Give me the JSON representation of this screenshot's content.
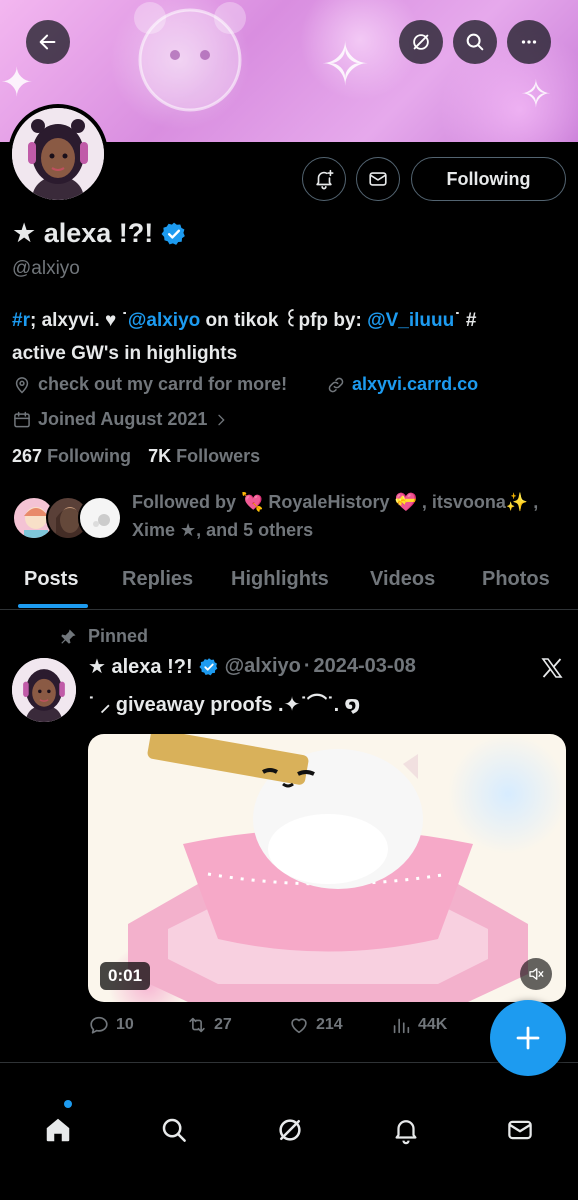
{
  "colors": {
    "accent": "#1d9bf0",
    "muted": "#71767b",
    "text": "#e7e9ea",
    "background": "#000000"
  },
  "header": {
    "back_icon": "arrow-left-icon",
    "grok_icon": "slash-circle-icon",
    "search_icon": "search-icon",
    "more_icon": "more-horizontal-icon"
  },
  "profile": {
    "display_name": "★ alexa !?!",
    "handle": "@alxiyo",
    "bio": {
      "part1_link": "#r",
      "part2": "; alxyvi.   ♥   ˙",
      "part3_link": "@alxiyo",
      "part4": " on tikok ꒰pfp by: ",
      "part5_link": "@V_iluuu",
      "part6": "˙ #",
      "line2": "active GW's in highlights"
    },
    "location": "check out my carrd for more!",
    "website": "alxyvi.carrd.co",
    "joined": "Joined August 2021",
    "following_count": "267",
    "following_label": "Following",
    "followers_count": "7K",
    "followers_label": "Followers",
    "followed_by": "Followed by 💘 RoyaleHistory 💝 , itsvoona✨ , Xime ★, and 5 others",
    "follow_button_label": "Following"
  },
  "tabs": [
    "Posts",
    "Replies",
    "Highlights",
    "Videos",
    "Photos"
  ],
  "active_tab": "Posts",
  "post": {
    "pinned_label": "Pinned",
    "author_name": "★ alexa !?!",
    "author_handle": "@alxiyo",
    "separator": "·",
    "date": "2024-03-08",
    "text": "˙ ⸝ giveaway proofs  .✦˙⌒˙. ໑",
    "video_time": "0:01",
    "replies": "10",
    "reposts": "27",
    "likes": "214",
    "views": "44K"
  },
  "bottom_nav": [
    "home-icon",
    "search-icon",
    "grok-icon",
    "notifications-icon",
    "messages-icon"
  ]
}
